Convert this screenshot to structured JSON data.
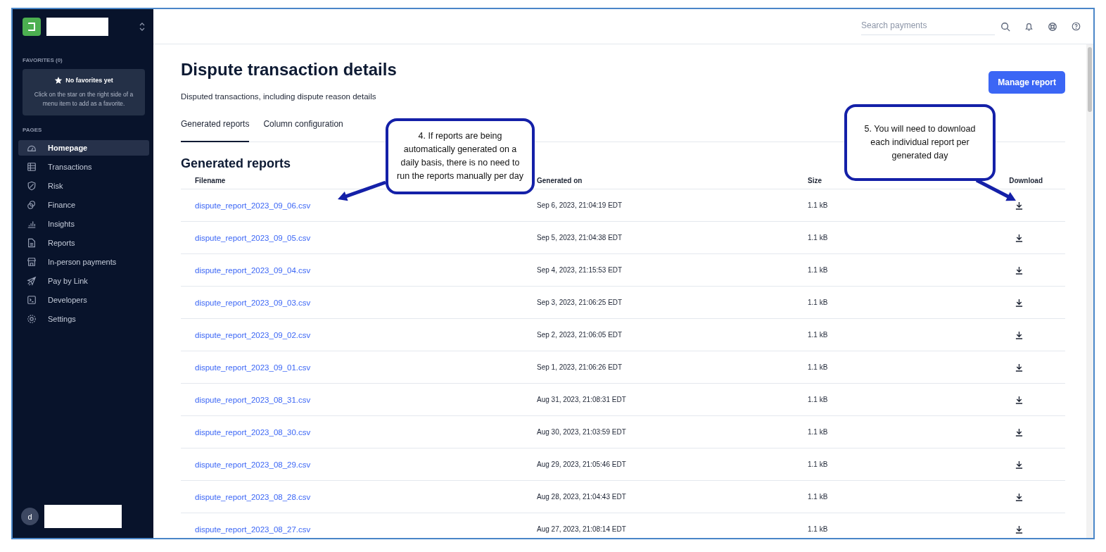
{
  "sidebar": {
    "favorites": {
      "heading": "FAVORITES (0)",
      "empty_title": "No favorites yet",
      "empty_text": "Click on the star on the right side of a menu item to add as a favorite."
    },
    "pages_heading": "PAGES",
    "items": [
      {
        "label": "Homepage",
        "selected": true
      },
      {
        "label": "Transactions",
        "selected": false
      },
      {
        "label": "Risk",
        "selected": false
      },
      {
        "label": "Finance",
        "selected": false
      },
      {
        "label": "Insights",
        "selected": false
      },
      {
        "label": "Reports",
        "selected": false
      },
      {
        "label": "In-person payments",
        "selected": false
      },
      {
        "label": "Pay by Link",
        "selected": false
      },
      {
        "label": "Developers",
        "selected": false
      },
      {
        "label": "Settings",
        "selected": false
      }
    ],
    "user_initial": "d"
  },
  "topbar": {
    "search": {
      "placeholder": "Search payments"
    }
  },
  "page": {
    "title": "Dispute transaction details",
    "subtitle": "Disputed transactions, including dispute reason details",
    "action": "Manage report",
    "tabs": [
      {
        "label": "Generated reports",
        "selected": true
      },
      {
        "label": "Column configuration",
        "selected": false
      }
    ],
    "section_title": "Generated reports",
    "table": {
      "columns": [
        "Filename",
        "Generated on",
        "Size",
        "Download"
      ],
      "rows": [
        {
          "filename": "dispute_report_2023_09_06.csv",
          "generated_on": "Sep 6, 2023, 21:04:19 EDT",
          "size": "1.1 kB"
        },
        {
          "filename": "dispute_report_2023_09_05.csv",
          "generated_on": "Sep 5, 2023, 21:04:38 EDT",
          "size": "1.1 kB"
        },
        {
          "filename": "dispute_report_2023_09_04.csv",
          "generated_on": "Sep 4, 2023, 21:15:53 EDT",
          "size": "1.1 kB"
        },
        {
          "filename": "dispute_report_2023_09_03.csv",
          "generated_on": "Sep 3, 2023, 21:06:25 EDT",
          "size": "1.1 kB"
        },
        {
          "filename": "dispute_report_2023_09_02.csv",
          "generated_on": "Sep 2, 2023, 21:06:05 EDT",
          "size": "1.1 kB"
        },
        {
          "filename": "dispute_report_2023_09_01.csv",
          "generated_on": "Sep 1, 2023, 21:06:26 EDT",
          "size": "1.1 kB"
        },
        {
          "filename": "dispute_report_2023_08_31.csv",
          "generated_on": "Aug 31, 2023, 21:08:31 EDT",
          "size": "1.1 kB"
        },
        {
          "filename": "dispute_report_2023_08_30.csv",
          "generated_on": "Aug 30, 2023, 21:03:59 EDT",
          "size": "1.1 kB"
        },
        {
          "filename": "dispute_report_2023_08_29.csv",
          "generated_on": "Aug 29, 2023, 21:05:46 EDT",
          "size": "1.1 kB"
        },
        {
          "filename": "dispute_report_2023_08_28.csv",
          "generated_on": "Aug 28, 2023, 21:04:43 EDT",
          "size": "1.1 kB"
        },
        {
          "filename": "dispute_report_2023_08_27.csv",
          "generated_on": "Aug 27, 2023, 21:08:14 EDT",
          "size": "1.1 kB"
        }
      ]
    }
  },
  "callouts": [
    {
      "text": "4. If reports are being automatically generated on a daily basis, there is no need to run the reports manually per day"
    },
    {
      "text": "5. You will need to download each individual report per generated day"
    }
  ]
}
